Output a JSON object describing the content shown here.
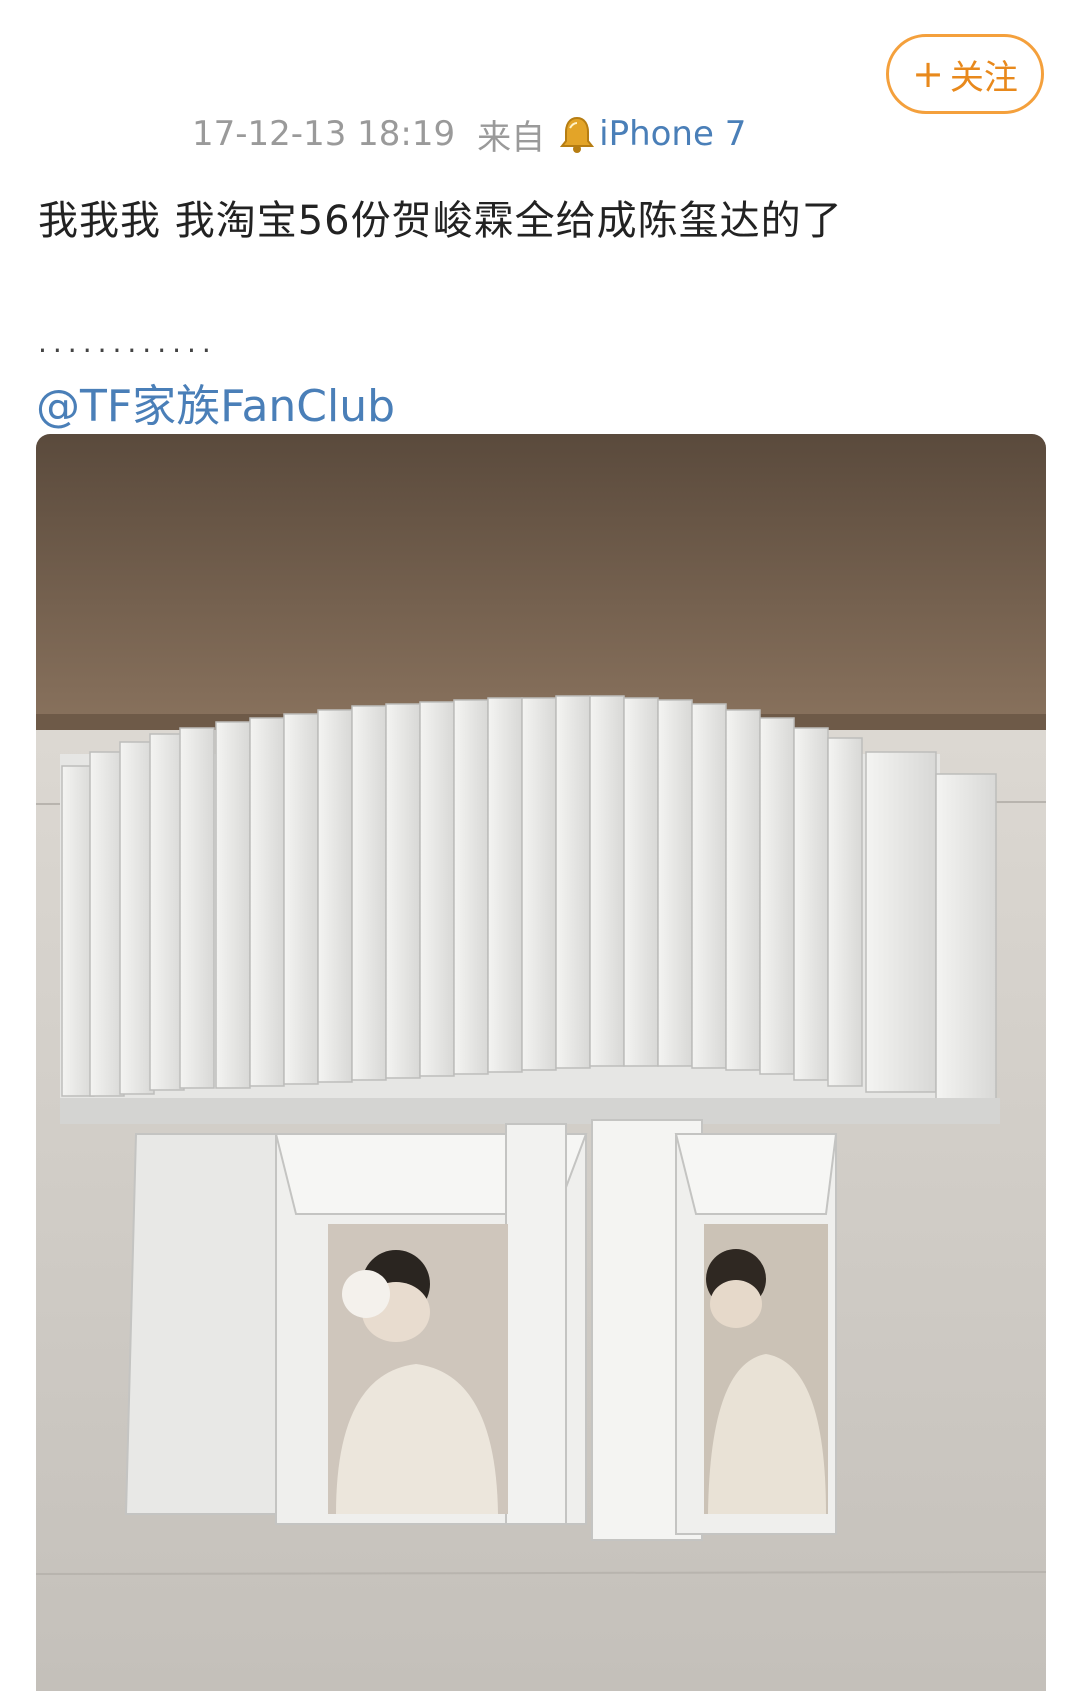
{
  "follow_button": {
    "plus": "+",
    "label": "关注"
  },
  "meta": {
    "timestamp": "17-12-13 18:19",
    "source_label": "来自",
    "device": "iPhone 7"
  },
  "post": {
    "text": "我我我 我淘宝56份贺峻霖全给成陈玺达的了",
    "dots": "............",
    "mention": "@TF家族FanClub"
  },
  "colors": {
    "accent": "#e8891c",
    "link": "#4a7fb8",
    "meta": "#9a9a9a"
  }
}
